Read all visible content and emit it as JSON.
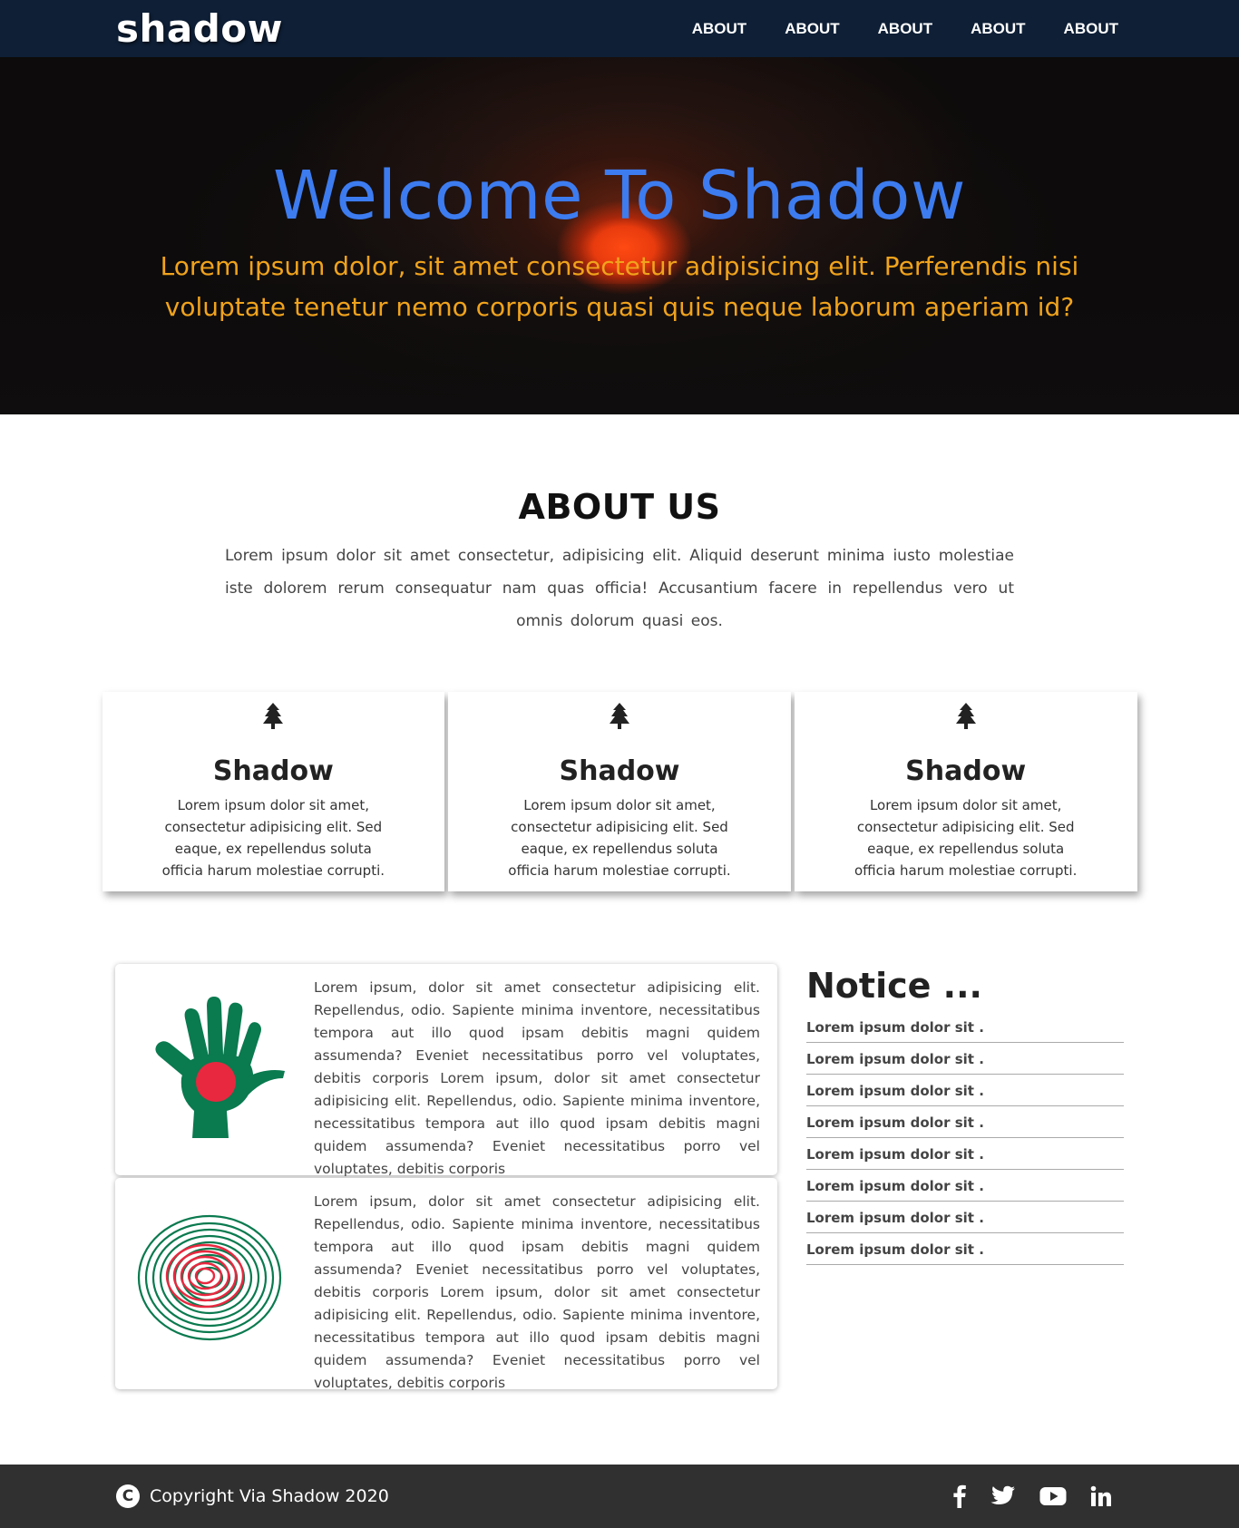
{
  "navbar": {
    "brand": "shadow",
    "links": [
      "ABOUT",
      "ABOUT",
      "ABOUT",
      "ABOUT",
      "ABOUT"
    ]
  },
  "hero": {
    "title": "Welcome To Shadow",
    "subtitle": "Lorem ipsum dolor, sit amet consectetur adipisicing elit. Perferendis nisi voluptate tenetur nemo corporis quasi quis neque laborum aperiam id?"
  },
  "about": {
    "title": "ABOUT US",
    "text": "Lorem ipsum dolor sit amet consectetur, adipisicing elit. Aliquid deserunt minima iusto molestiae iste dolorem rerum consequatur nam quas officia! Accusantium facere in repellendus vero ut omnis dolorum quasi eos."
  },
  "cards": [
    {
      "icon": "tree-icon",
      "title": "Shadow",
      "text": "Lorem ipsum dolor sit amet, consectetur adipisicing elit. Sed eaque, ex repellendus soluta officia harum molestiae corrupti."
    },
    {
      "icon": "tree-icon",
      "title": "Shadow",
      "text": "Lorem ipsum dolor sit amet, consectetur adipisicing elit. Sed eaque, ex repellendus soluta officia harum molestiae corrupti."
    },
    {
      "icon": "tree-icon",
      "title": "Shadow",
      "text": "Lorem ipsum dolor sit amet, consectetur adipisicing elit. Sed eaque, ex repellendus soluta officia harum molestiae corrupti."
    }
  ],
  "posts": [
    {
      "image": "bangladesh-flag-hand",
      "text": "Lorem ipsum, dolor sit amet consectetur adipisicing elit. Repellendus, odio. Sapiente minima inventore, necessitatibus tempora aut illo quod ipsam debitis magni quidem assumenda? Eveniet necessitatibus porro vel voluptates, debitis corporis Lorem ipsum, dolor sit amet consectetur adipisicing elit. Repellendus, odio. Sapiente minima inventore, necessitatibus tempora aut illo quod ipsam debitis magni quidem assumenda? Eveniet necessitatibus porro vel voluptates, debitis corporis"
    },
    {
      "image": "bangladesh-flag-fingerprint",
      "text": "Lorem ipsum, dolor sit amet consectetur adipisicing elit. Repellendus, odio. Sapiente minima inventore, necessitatibus tempora aut illo quod ipsam debitis magni quidem assumenda? Eveniet necessitatibus porro vel voluptates, debitis corporis Lorem ipsum, dolor sit amet consectetur adipisicing elit. Repellendus, odio. Sapiente minima inventore, necessitatibus tempora aut illo quod ipsam debitis magni quidem assumenda? Eveniet necessitatibus porro vel voluptates, debitis corporis"
    }
  ],
  "notice": {
    "title": "Notice ...",
    "items": [
      "Lorem ipsum dolor sit .",
      "Lorem ipsum dolor sit .",
      "Lorem ipsum dolor sit .",
      "Lorem ipsum dolor sit .",
      "Lorem ipsum dolor sit .",
      "Lorem ipsum dolor sit .",
      "Lorem ipsum dolor sit .",
      "Lorem ipsum dolor sit ."
    ]
  },
  "footer": {
    "copyright_icon": "copyright-icon",
    "copyright": "Copyright Via Shadow 2020",
    "socials": [
      "facebook-icon",
      "twitter-icon",
      "youtube-icon",
      "linkedin-icon"
    ]
  },
  "colors": {
    "navbar_bg": "#0e1f36",
    "hero_title": "#3d7cf0",
    "hero_subtitle": "#f0a31c",
    "footer_bg": "#303030",
    "flag_green": "#0a7a4f",
    "flag_red": "#e8283f"
  }
}
